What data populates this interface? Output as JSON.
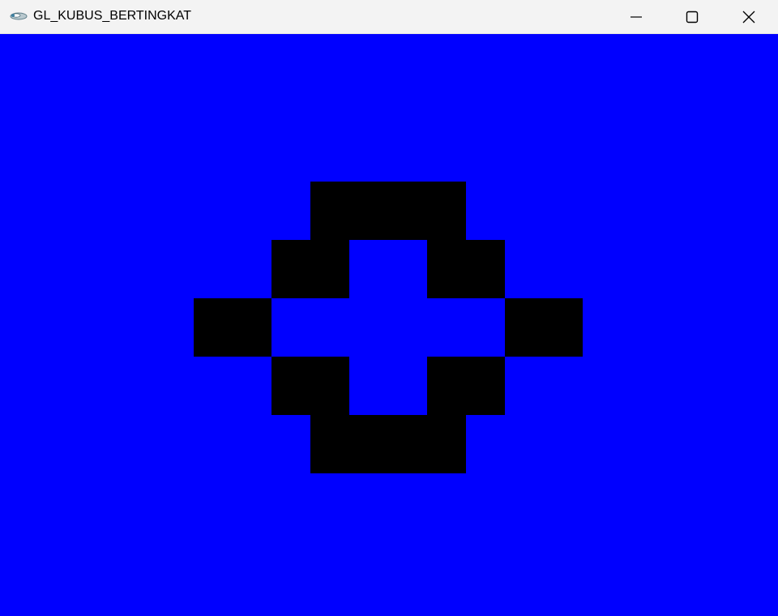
{
  "window": {
    "title": "GL_KUBUS_BERTINGKAT",
    "canvas_color": "#0000ff",
    "shape_color": "#000000"
  },
  "icons": {
    "app": "opengl-glut-app-icon",
    "minimize": "minimize-icon",
    "maximize": "maximize-icon",
    "close": "close-icon"
  }
}
